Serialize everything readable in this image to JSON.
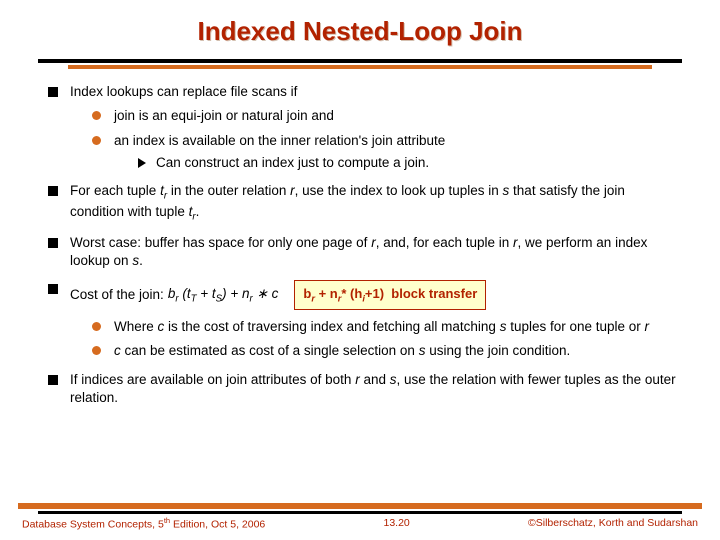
{
  "title": "Indexed Nested-Loop Join",
  "b1": "Index lookups can replace file scans if",
  "b1a": "join is an equi-join or natural join and",
  "b1b": "an index is available on the inner relation's join attribute",
  "b1b1": "Can construct an index just to compute a join.",
  "b2_pre": "For each tuple ",
  "b2_mid1": " in the outer relation ",
  "b2_mid2": ", use the index to look up tuples in ",
  "b2_mid3": " that satisfy the join condition with tuple ",
  "b3_pre": "Worst case:  buffer has space for only one page of ",
  "b3_mid": ", and, for each tuple in ",
  "b3_end": ", we perform an index lookup on ",
  "b4_label": "Cost of the join:  ",
  "b4_box_html": "b_r + n_r* (h_i+1)  block transfer",
  "b4a_pre": "Where ",
  "b4a_mid": " is the cost of traversing index and fetching all matching ",
  "b4a_end": " tuples for one tuple or ",
  "b4b_1": " can be estimated as cost of a single selection on ",
  "b4b_2": " using the join condition.",
  "b5_pre": "If indices are available on join attributes of both ",
  "b5_mid": " and ",
  "b5_end": ", use the relation with fewer tuples as the outer relation.",
  "footer_left": "Database System Concepts, 5th Edition, Oct 5, 2006",
  "footer_center": "13.20",
  "footer_right": "©Silberschatz, Korth and Sudarshan",
  "sym": {
    "tr": "t",
    "r": "r",
    "s": "s",
    "c": "c",
    "br": "b",
    "nr": "n",
    "hi": "h",
    "tt": "t",
    "ts": "t"
  }
}
